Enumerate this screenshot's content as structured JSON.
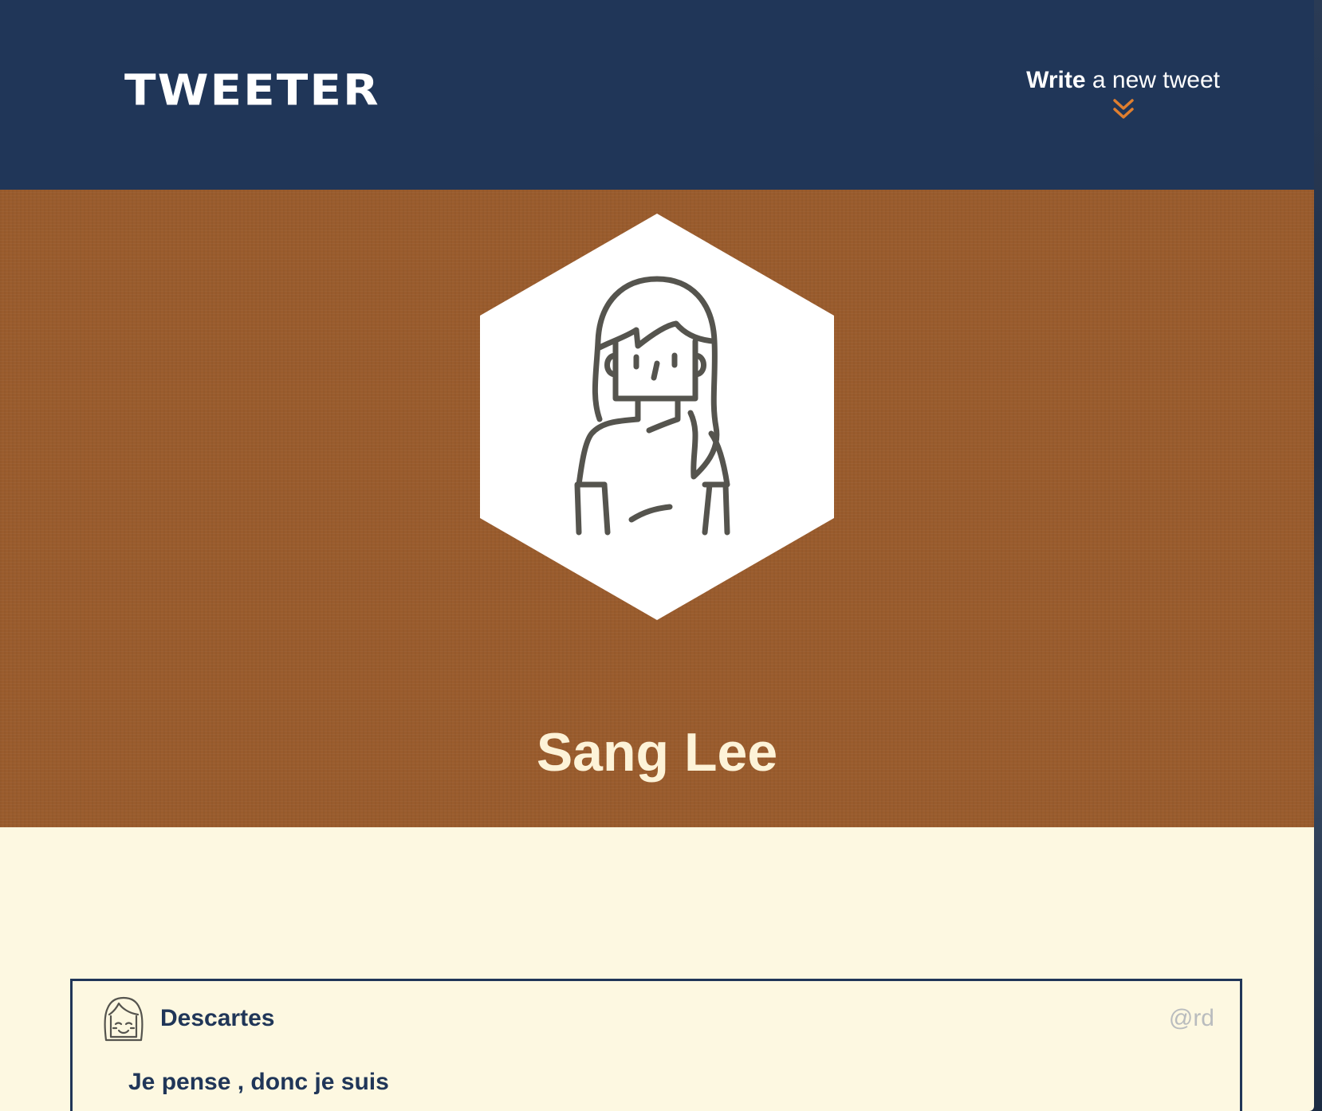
{
  "header": {
    "logo": "TWEETER",
    "compose_bold": "Write",
    "compose_rest": " a new tweet",
    "compose_icon": "double-chevron-down-icon",
    "accent_color": "#e07f2f",
    "background_color": "#203658"
  },
  "profile": {
    "avatar_icon": "woman-avatar-icon",
    "name": "Sang Lee",
    "banner_color": "#9a5c2d"
  },
  "tweets": [
    {
      "avatar_icon": "smiling-girl-avatar-icon",
      "name": "Descartes",
      "handle": "@rd",
      "text": "Je pense , donc je suis"
    }
  ]
}
